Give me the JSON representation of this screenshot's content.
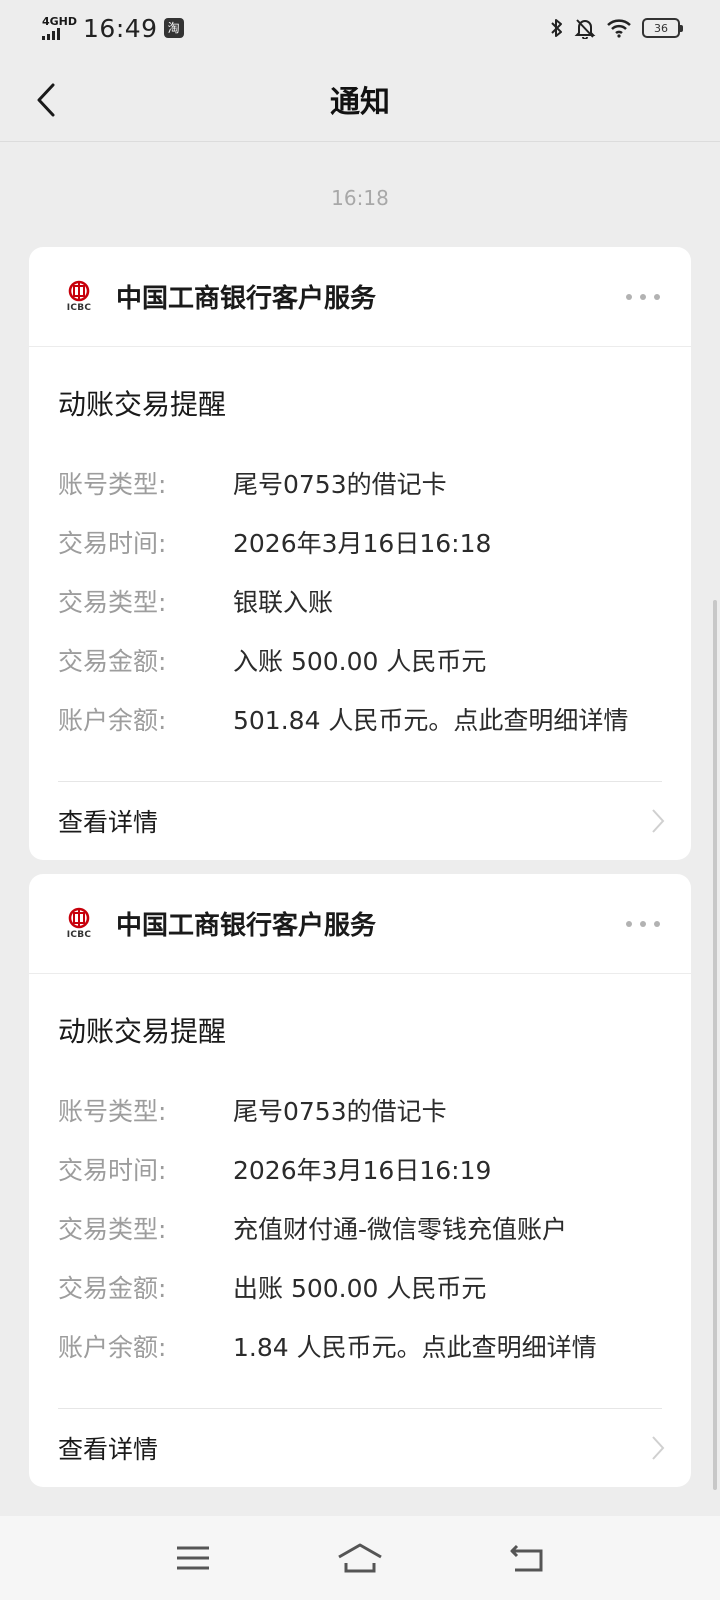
{
  "status_bar": {
    "network": "4GHD",
    "time": "16:49",
    "app_badge": "淘",
    "battery": "36"
  },
  "header": {
    "title": "通知"
  },
  "feed": {
    "timestamp": "16:18"
  },
  "messages": [
    {
      "sender": "中国工商银行客户服务",
      "logo_text": "ICBC",
      "title": "动账交易提醒",
      "rows": [
        {
          "label": "账号类型:",
          "value": "尾号0753的借记卡"
        },
        {
          "label": "交易时间:",
          "value": "2026年3月16日16:18"
        },
        {
          "label": "交易类型:",
          "value": "银联入账"
        },
        {
          "label": "交易金额:",
          "value": "入账 500.00 人民币元"
        },
        {
          "label": "账户余额:",
          "value": "501.84 人民币元。点此查明细详情"
        }
      ],
      "detail_label": "查看详情"
    },
    {
      "sender": "中国工商银行客户服务",
      "logo_text": "ICBC",
      "title": "动账交易提醒",
      "rows": [
        {
          "label": "账号类型:",
          "value": "尾号0753的借记卡"
        },
        {
          "label": "交易时间:",
          "value": "2026年3月16日16:19"
        },
        {
          "label": "交易类型:",
          "value": "充值财付通-微信零钱充值账户"
        },
        {
          "label": "交易金额:",
          "value": "出账 500.00 人民币元"
        },
        {
          "label": "账户余额:",
          "value": "1.84 人民币元。点此查明细详情"
        }
      ],
      "detail_label": "查看详情"
    }
  ],
  "icons": {
    "back": "chevron-left-icon",
    "more": "more-dots-icon",
    "detail": "chevron-right-icon",
    "bottom_nav": [
      "menu-icon",
      "home-icon",
      "back-icon"
    ]
  },
  "colors": {
    "page_bg": "#ededed",
    "card_bg": "#ffffff",
    "label_gray": "#9d9d9d",
    "icbc_red": "#c7000b"
  }
}
